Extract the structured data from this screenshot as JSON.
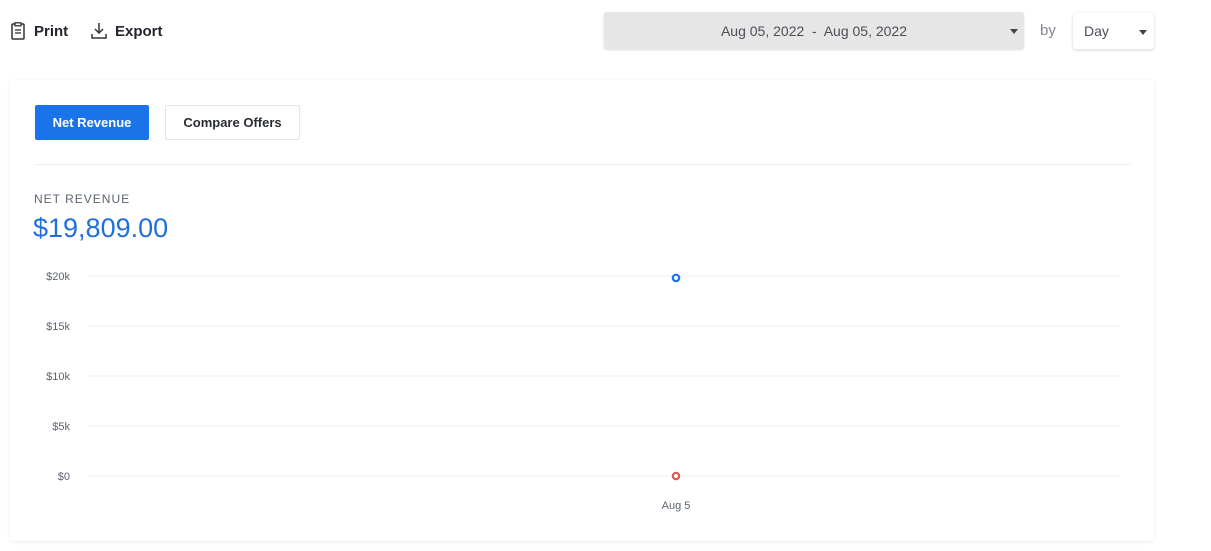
{
  "toolbar": {
    "print_label": "Print",
    "export_label": "Export",
    "date_range": "Aug 05, 2022  -  Aug 05, 2022",
    "by_label": "by",
    "period": "Day"
  },
  "tabs": {
    "net_revenue": "Net Revenue",
    "compare_offers": "Compare Offers"
  },
  "metric": {
    "label": "NET REVENUE",
    "value": "$19,809.00"
  },
  "colors": {
    "accent": "#1a73e8",
    "series_primary": "#1a73e8",
    "series_secondary": "#e0574f",
    "gridline": "#eef0f2"
  },
  "chart_data": {
    "type": "scatter",
    "x": [
      "Aug 5"
    ],
    "series": [
      {
        "values": [
          19809
        ]
      },
      {
        "values": [
          0
        ]
      }
    ],
    "ylim": [
      0,
      20000
    ],
    "yticks": [
      0,
      5000,
      10000,
      15000,
      20000
    ],
    "ytick_labels": [
      "$0",
      "$5k",
      "$10k",
      "$15k",
      "$20k"
    ],
    "grid": true
  }
}
